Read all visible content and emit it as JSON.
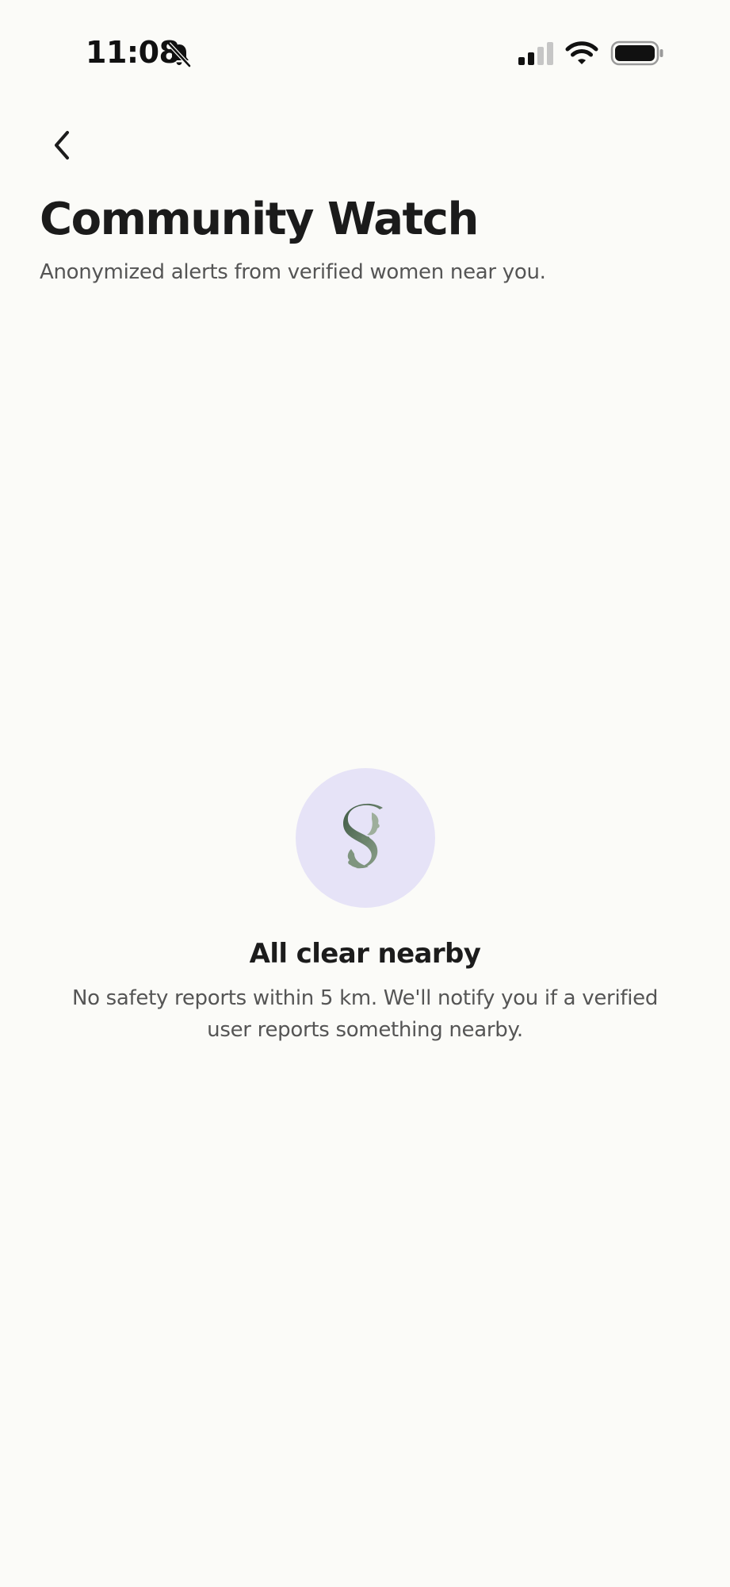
{
  "status_bar": {
    "time": "11:08",
    "icons": [
      "bell-slash-icon",
      "cellular-signal-icon",
      "wifi-icon",
      "battery-icon"
    ]
  },
  "header": {
    "back_icon": "chevron-left-icon",
    "title": "Community Watch",
    "subtitle": "Anonymized alerts from verified women near you."
  },
  "empty_state": {
    "logo_icon": "app-logo-s-icon",
    "title": "All clear nearby",
    "description": "No safety reports within 5 km. We'll notify you if a verified user reports something nearby."
  },
  "colors": {
    "background": "#fbfbf8",
    "logo_circle": "#e6e3f7",
    "logo_green": "#5f7a60",
    "text_primary": "#1c1c1c",
    "text_secondary": "#555555"
  }
}
